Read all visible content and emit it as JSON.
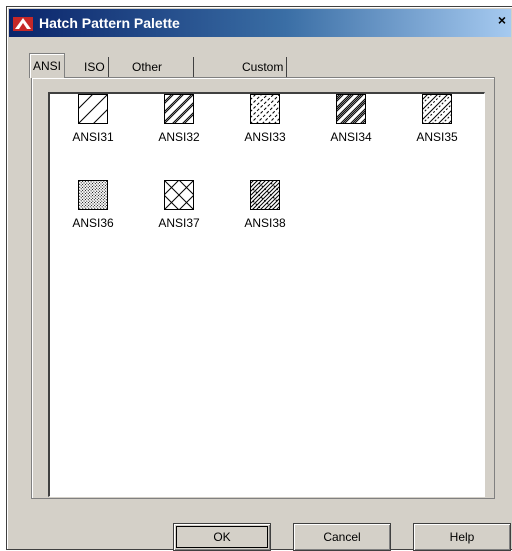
{
  "window": {
    "title": "Hatch Pattern Palette",
    "close_glyph": "×"
  },
  "tabs": [
    {
      "label": "ANSI",
      "active": true
    },
    {
      "label": "ISO",
      "active": false
    },
    {
      "label": "Other Predefined",
      "active": false
    },
    {
      "label": "Custom",
      "active": false
    }
  ],
  "patterns": [
    {
      "name": "ANSI31",
      "style": "single-diagonal"
    },
    {
      "name": "ANSI32",
      "style": "double-diagonal"
    },
    {
      "name": "ANSI33",
      "style": "dashed-diagonal"
    },
    {
      "name": "ANSI34",
      "style": "dense-diagonal-bands"
    },
    {
      "name": "ANSI35",
      "style": "alternating-diagonal"
    },
    {
      "name": "ANSI36",
      "style": "dotted-dense"
    },
    {
      "name": "ANSI37",
      "style": "crosshatch"
    },
    {
      "name": "ANSI38",
      "style": "dense-crosshatch"
    }
  ],
  "buttons": {
    "ok": "OK",
    "cancel": "Cancel",
    "help": "Help"
  },
  "colors": {
    "title_bar_start": "#0a246a",
    "title_bar_end": "#a6caf0",
    "dialog_face": "#d4d0c8"
  }
}
